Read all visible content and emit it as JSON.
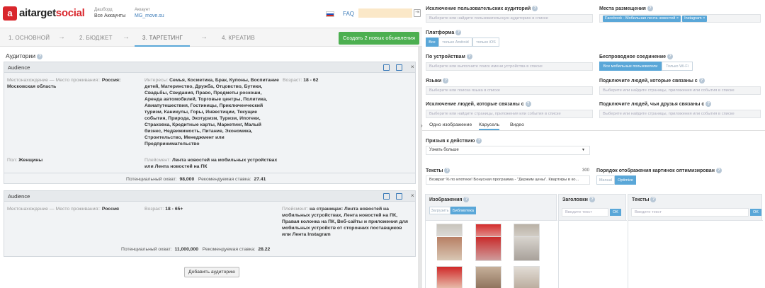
{
  "brand": {
    "name_part1": "aitarget",
    "name_part2": "social",
    "mark": "a"
  },
  "header": {
    "dashboard_label": "Дашборд",
    "dashboard_value": "Все Аккаунты",
    "account_label": "Аккаунт",
    "account_value": "MG_move.su",
    "faq": "FAQ"
  },
  "steps": [
    {
      "label": "1. ОСНОВНОЙ"
    },
    {
      "label": "2. БЮДЖЕТ"
    },
    {
      "label": "3. ТАРГЕТИНГ"
    },
    {
      "label": "4. КРЕАТИВ"
    }
  ],
  "arrow": "→",
  "create_button": "Создать 2 новых объявления",
  "audiences_title": "Аудитории",
  "help": "?",
  "audience1": {
    "title": "Audience",
    "loc_label": "Местонахождение — Место проживания::",
    "loc_value": "Россия: Московская область",
    "interests_label": "Интересы:",
    "interests_value": "Семья, Косметика, Брак, Купоны, Воспитание детей, Материнство, Дружба, Отцовство, Бутики, Свадьбы, Свидания, Право, Предметы роскоши, Аренда автомобилей, Торговые центры, Политика, Авиапутешествия, Гостиницы, Приключенческий туризм, Каникулы, Горы, Инвестиции, Текущие события, Природа, Экотуризм, Туризм, Ипотеки, Страховка, Кредитные карты, Маркетинг, Малый бизнес, Недвижимость, Питание, Экономика, Строительство, Менеджмент или Предпринимательство",
    "age_label": "Возраст:",
    "age_value": "18 - 62",
    "gender_label": "Пол:",
    "gender_value": "Женщины",
    "placement_label": "Плейсмент:",
    "placement_value": "Лента новостей на мобильных устройствах или Лента новостей на ПК",
    "reach_label": "Потенциальный охват:",
    "reach_value": "98,000",
    "bid_label": "Рекомендуемая ставка:",
    "bid_value": "27.41"
  },
  "audience2": {
    "title": "Audience",
    "loc_label": "Местонахождение — Место проживания::",
    "loc_value": "Россия",
    "age_label": "Возраст:",
    "age_value": "18 - 65+",
    "placement_label": "Плейсмент:",
    "placement_value": "на страницах: Лента новостей на мобильных устройствах, Лента новостей на ПК, Правая колонка на ПК, Веб-сайты и приложения для мобильных устройств от сторонних поставщиков или Лента Instagram",
    "reach_label": "Потенциальный охват:",
    "reach_value": "11,000,000",
    "bid_label": "Рекомендуемая ставка:",
    "bid_value": "28.22"
  },
  "add_audience": "Добавить аудиторию",
  "right": {
    "exclude_audiences_label": "Исключение пользовательских аудиторий",
    "exclude_audiences_placeholder": "Выберите или найдите пользовательскую аудиторию в списке",
    "placements_label": "Места размещения",
    "placement_tags": [
      "Facebook - Мобильная лента новостей",
      "Instagram"
    ],
    "platform_label": "Платформа",
    "platform_options": [
      "Все",
      "только Android",
      "только iOS"
    ],
    "devices_label": "По устройствам",
    "devices_placeholder": "Выберите или выполните поиск имени устройства в списке",
    "wireless_label": "Беспроводное соединение",
    "wireless_options": [
      "Все мобильные пользователи",
      "Только Wi-Fi"
    ],
    "languages_label": "Языки",
    "languages_placeholder": "Выберите или поиска языка в списке",
    "connected_label": "Подключите людей, которые связаны с",
    "connected_placeholder": "Выберите или найдите страницы, приложения или события в списке",
    "exclude_connected_label": "Исключение людей, которые связаны с",
    "exclude_connected_placeholder": "Выберите или найдите страницы, приложения или события в списке",
    "friends_connected_label": "Подключите людей, чьи друзья связаны с",
    "friends_connected_placeholder": "Выберите или найдите страницы, приложения или события в списке",
    "tabs": [
      "Одно изображение",
      "Карусель",
      "Видео"
    ],
    "cta_label": "Призыв к действию",
    "cta_value": "Узнать больше",
    "texts_label": "Тексты",
    "texts_counter": "300",
    "texts_value": "Возврат % по ипотеке! Бонусная программа - \"Держим цены\". Квартиры в ко...",
    "order_label": "Порядок отображения картинок оптимизирован",
    "order_options": [
      "Manual",
      "Optimize"
    ],
    "images_label": "Изображения",
    "image_tabs": [
      "Загрузить",
      "Библиотека"
    ],
    "headlines_label": "Заголовки",
    "headlines_placeholder": "Введите текст",
    "texts2_label": "Тексты",
    "texts2_placeholder": "Введите текст",
    "ok": "OK"
  }
}
